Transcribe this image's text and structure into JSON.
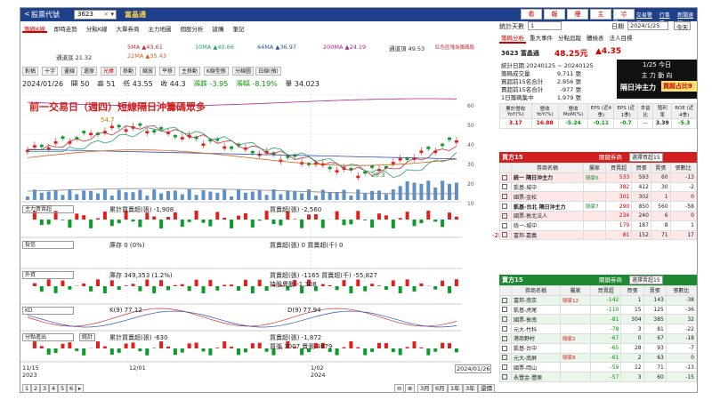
{
  "topbar": {
    "back": "<",
    "title": "股票代號",
    "code": "3623",
    "name": "富晶通",
    "btns": [
      "看",
      "報",
      "樓",
      "主",
      "哈"
    ],
    "links": [
      "個股資訊",
      "交易警示",
      "行事曆",
      "新聞速報"
    ]
  },
  "left_tabs": [
    "籌碼K線",
    "即時走勢",
    "分點K線",
    "大單券商",
    "主力地圖",
    "個股分析",
    "搶購",
    "筆記"
  ],
  "ma_legend": {
    "ma5": "5MA ▲43.61",
    "ma10": "10MA ▲40.66",
    "ma64": "64MA ▲36.97",
    "ma200": "200MA ▲24.19",
    "upper": "通道頂 49.53",
    "note": "紅色區塊為籌碼股",
    "ma22": "22MA ▲35.43",
    "lower": "通道底 21.32"
  },
  "toolbar2": [
    "對稱",
    "十字",
    "畫線",
    "還原",
    "光棒",
    "移動",
    "縮放",
    "平移",
    "主移動",
    "K線型態",
    "分線圖",
    "日線(預)"
  ],
  "info": {
    "date": "2024/01/26",
    "open": "開 50",
    "high": "高 51",
    "low": "低 43.55",
    "close": "收 44.3",
    "change": "漲跌 -3.95",
    "pct": "漲幅 -8.19%",
    "vol": "量 34,023"
  },
  "annotation": "前一交易日（週四）短線隔日沖籌碼眾多",
  "price_labels": {
    "high": "54.7",
    "low": "28.3"
  },
  "sub_panels": [
    {
      "select": "主力買賣超",
      "l1": "累計買賣超(張) -1,908",
      "l2": "買賣超(張) -2,560",
      "val": "-2817"
    },
    {
      "select": "投信",
      "l1": "庫存 0 (0%)",
      "l2": "買賣超(張) 0 買賣超(千) 0"
    },
    {
      "select": "外資",
      "l1": "庫存 349,353 (1.2%)",
      "l2": "買賣超(張) -1165 買賣超(千) -55,827",
      "l3": "持股異動 -1,308"
    },
    {
      "select": "KD",
      "l1": "K(9) 77.12",
      "l2": "D(9) 77.94"
    },
    {
      "select": "分點進出",
      "btn": "統計",
      "l1": "累計買賣超(張) -630",
      "l2": "買賣超(張) -1,872",
      "l3": "買張 3007 賣張 4879"
    }
  ],
  "x_axis": [
    "11/15\n2023",
    "12/01",
    "1/02\n2024",
    "2024/01/26"
  ],
  "y_right": [
    "60",
    "50",
    "40",
    "30",
    "20",
    "10"
  ],
  "pager": [
    "1",
    "2",
    "3",
    "4",
    "5",
    "6"
  ],
  "zoom_btns": [
    "3月",
    "6月",
    "1年",
    "3年",
    "還價"
  ],
  "right_panel": {
    "stat_label": "統計天數",
    "stat_value": "1",
    "date_label": "日期",
    "date_value": "2024/1/25",
    "today": "今天",
    "tabs": [
      "籌碼分析",
      "重大事件",
      "分點追蹤",
      "體檢表",
      "法人目標"
    ],
    "stock": "3623 富晶通",
    "price": "48.25元",
    "chg": "▲4.35",
    "period": "統計日期 20240125 ~ 20240125",
    "card_date": "1/25 今日",
    "card_sub": "主 力 動 向",
    "card_tag1": "隔日沖主力",
    "card_tag2": "買超占比9",
    "stats": [
      {
        "k": "籌碼成交量",
        "v": "9,711 張"
      },
      {
        "k": "買超前15名合計",
        "v": "2,956 張"
      },
      {
        "k": "賣超前15名合計",
        "v": "-977 張"
      },
      {
        "k": "1日籌碼集中",
        "v": "1,979 張"
      }
    ],
    "fin_head": [
      "累計營收 YoY(%)",
      "營收 YoY(%)",
      "營收 MoM(%)",
      "EPS (近4季)",
      "EPS (近1季)",
      "本益 比",
      "殖利 率",
      "ROE (近4季)"
    ],
    "fin_vals": [
      "3.17",
      "16.88",
      "-5.24",
      "-0.11",
      "-0.7",
      "--",
      "3.39",
      "-5.3"
    ],
    "buy_hdr": "買方15",
    "buy_kw_label": "關鍵券商",
    "buy_kw": "選擇買超15",
    "cols": [
      "券商名稱",
      "屬家",
      "買賣超",
      "買張",
      "賣張",
      "張數比"
    ],
    "buy_rows": [
      [
        "統一 隔日沖主力",
        "隔家6",
        "533",
        "593",
        "60",
        "-13"
      ],
      [
        "凱基-城中",
        "",
        "382",
        "412",
        "30",
        "-2"
      ],
      [
        "國票-金松",
        "",
        "301",
        "302",
        "1",
        "0"
      ],
      [
        "凱基-台北 隔日沖主力",
        "隔家7",
        "290",
        "850",
        "560",
        "-58"
      ],
      [
        "國票-敦北法人",
        "",
        "234",
        "240",
        "6",
        "0"
      ],
      [
        "統一-城中",
        "",
        "179",
        "187",
        "8",
        "1"
      ],
      [
        "富邦-嘉義",
        "",
        "81",
        "152",
        "71",
        "17"
      ]
    ],
    "sell_hdr": "賣方15",
    "sell_kw": "選擇賣超15",
    "sell_rows": [
      [
        "富邦-南京",
        "隔家12",
        "-142",
        "1",
        "143",
        "-38"
      ],
      [
        "凱基-虎尾",
        "",
        "-110",
        "15",
        "125",
        "-36"
      ],
      [
        "國票-敦南",
        "",
        "-81",
        "304",
        "385",
        "32"
      ],
      [
        "元大-竹科",
        "",
        "-78",
        "3",
        "81",
        "-22"
      ],
      [
        "港商野村",
        "隔家2",
        "-67",
        "0",
        "67",
        "-18"
      ],
      [
        "凱基-台中",
        "",
        "-65",
        "28",
        "93",
        "-7"
      ],
      [
        "元大-南屏",
        "隔家8",
        "-61",
        "2",
        "63",
        "0"
      ],
      [
        "國票-岡山",
        "",
        "-59",
        "12",
        "71",
        "-13"
      ],
      [
        "永豐金-豐原",
        "",
        "-57",
        "3",
        "60",
        "-15"
      ]
    ]
  },
  "colors": {
    "up": "#e0201a",
    "down": "#0d9a2c",
    "accent": "#1e3f8a"
  }
}
